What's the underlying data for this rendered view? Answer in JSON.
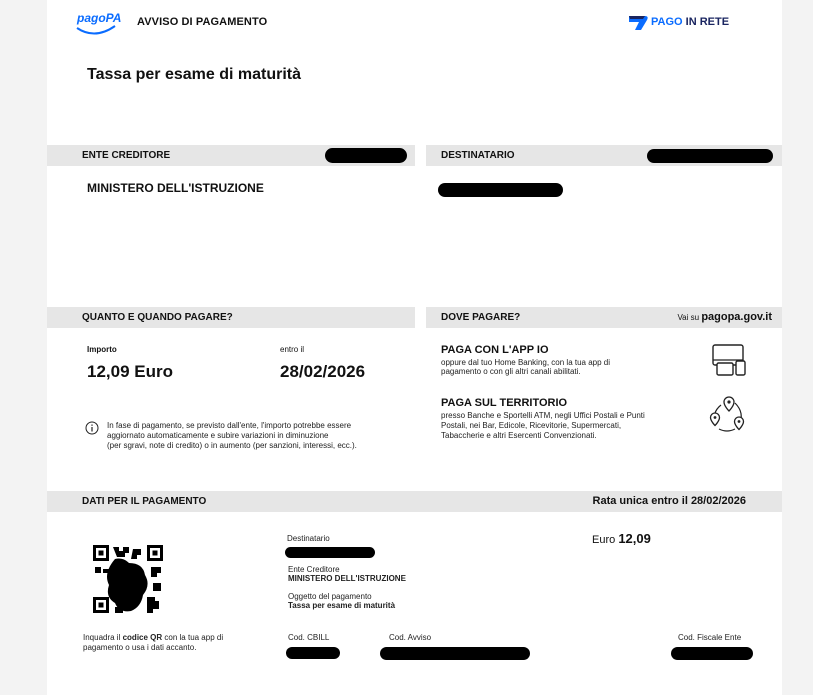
{
  "header": {
    "logo_text": "pagoPA",
    "doc_title": "AVVISO DI PAGAMENTO",
    "pago_brand_a": "PAGO",
    "pago_brand_b": " IN RETE",
    "main_title": "Tassa per esame di maturità"
  },
  "creditor": {
    "bar_label": "ENTE CREDITORE",
    "name": "MINISTERO DELL'ISTRUZIONE"
  },
  "recipient": {
    "bar_label": "DESTINATARIO"
  },
  "when": {
    "bar_label": "QUANTO E QUANDO PAGARE?",
    "amount_label": "Importo",
    "amount": "12,09 Euro",
    "due_label": "entro il",
    "due_date": "28/02/2026",
    "note_line1": "In fase di pagamento, se previsto dall'ente, l'importo potrebbe essere",
    "note_line2": "aggiornato automaticamente e subire variazioni in diminuzione",
    "note_line3": "(per sgravi, note di credito) o in aumento (per sanzioni, interessi, ecc.)."
  },
  "where": {
    "bar_label": "DOVE PAGARE?",
    "link_prefix": "Vai su ",
    "link": "pagopa.gov.it",
    "app_title": "PAGA CON L'APP IO",
    "app_line1": "oppure dal tuo Home Banking, con la tua app di",
    "app_line2": "pagamento o con gli altri canali abilitati.",
    "terr_title": "PAGA SUL TERRITORIO",
    "terr_line1": "presso Banche e Sportelli ATM, negli Uffici Postali e Punti",
    "terr_line2": "Postali, nei Bar, Edicole, Ricevitorie, Supermercati,",
    "terr_line3": "Tabaccherie e altri Esercenti Convenzionati."
  },
  "payment": {
    "bar_label": "DATI PER IL PAGAMENTO",
    "rata_bold": "Rata unica",
    "rata_rest": "entro il 28/02/2026",
    "dest_label": "Destinatario",
    "ente_label": "Ente Creditore",
    "ente_value": "MINISTERO DELL'ISTRUZIONE",
    "oggetto_label": "Oggetto del pagamento",
    "oggetto_value": "Tassa per esame di maturità",
    "euro_label": "Euro",
    "euro_value": "12,09",
    "qr_line1_a": "Inquadra il ",
    "qr_line1_b": "codice QR",
    "qr_line1_c": " con la tua app di",
    "qr_line2": "pagamento o usa i dati accanto.",
    "cbill_label": "Cod. CBILL",
    "avviso_label": "Cod. Avviso",
    "fiscale_label": "Cod. Fiscale Ente"
  },
  "colors": {
    "bar_bg": "#e6e6e6",
    "brand_blue": "#0a6cff",
    "brand_navy": "#1a2560"
  }
}
